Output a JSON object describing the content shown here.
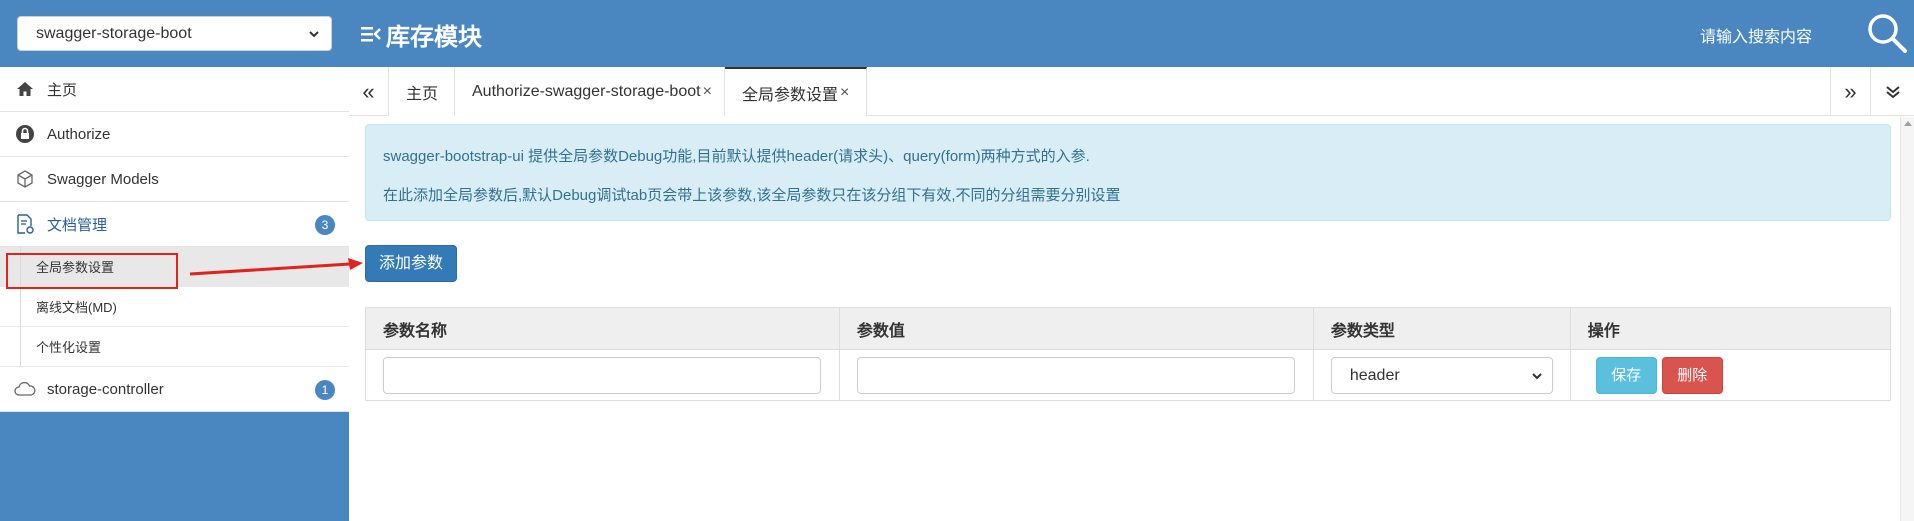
{
  "header": {
    "group_select": "swagger-storage-boot",
    "module_title": "库存模块",
    "search_hint": "请输入搜索内容"
  },
  "sidebar": {
    "items": [
      {
        "label": "主页",
        "icon": "home-icon"
      },
      {
        "label": "Authorize",
        "icon": "lock-icon"
      },
      {
        "label": "Swagger Models",
        "icon": "cube-icon"
      },
      {
        "label": "文档管理",
        "icon": "doc-settings-icon",
        "badge": "3"
      },
      {
        "label": "storage-controller",
        "icon": "cloud-icon",
        "badge": "1"
      }
    ],
    "sub_items": [
      {
        "label": "全局参数设置"
      },
      {
        "label": "离线文档(MD)"
      },
      {
        "label": "个性化设置"
      }
    ]
  },
  "tabs": {
    "prev_icon": "«",
    "next_icon": "»",
    "items": [
      {
        "label": "主页",
        "closable": false
      },
      {
        "label": "Authorize-swagger-storage-boot",
        "closable": true,
        "close": "×"
      },
      {
        "label": "全局参数设置",
        "closable": true,
        "close": "×"
      }
    ]
  },
  "content": {
    "info_line1": "swagger-bootstrap-ui 提供全局参数Debug功能,目前默认提供header(请求头)、query(form)两种方式的入参.",
    "info_line2": "在此添加全局参数后,默认Debug调试tab页会带上该参数,该全局参数只在该分组下有效,不同的分组需要分别设置",
    "add_button": "添加参数",
    "table": {
      "headers": [
        "参数名称",
        "参数值",
        "参数类型",
        "操作"
      ],
      "row": {
        "name_value": "",
        "value_value": "",
        "type_value": "header",
        "save_label": "保存",
        "delete_label": "删除"
      }
    }
  },
  "colors": {
    "brand": "#4a87c0",
    "info_bg": "#d9edf7",
    "primary": "#337ab7",
    "save": "#5bc0de",
    "delete": "#d9534f",
    "annotation": "#e0231c"
  }
}
